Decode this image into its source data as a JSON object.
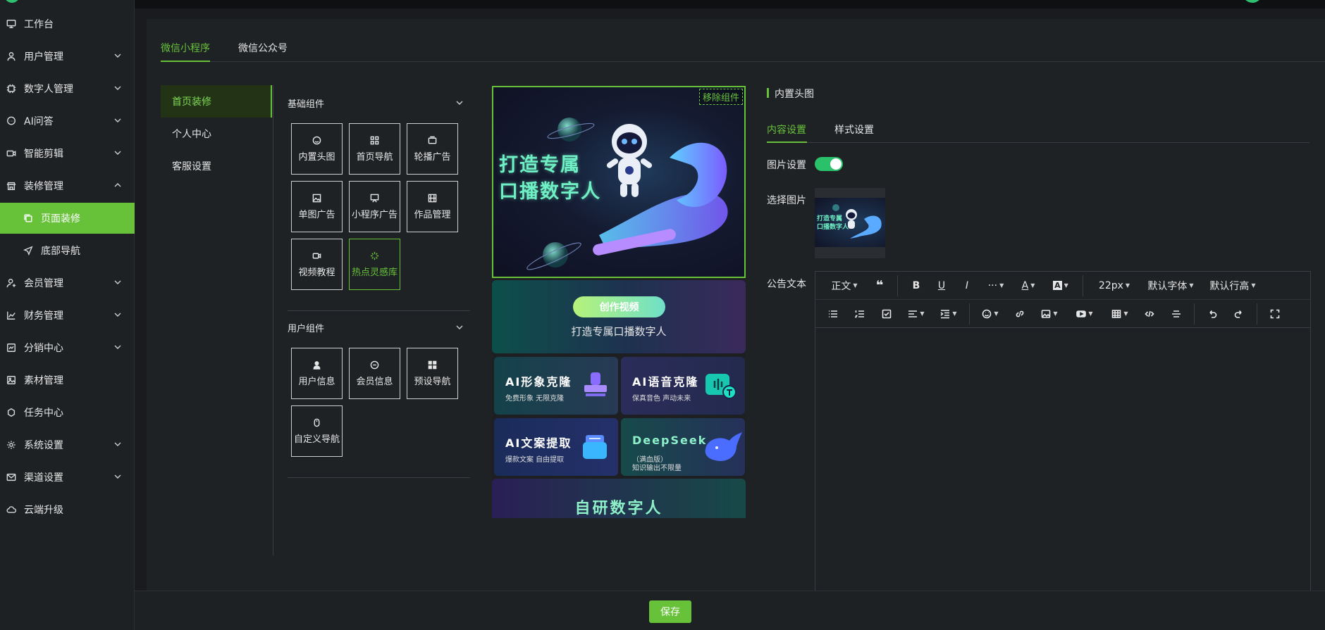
{
  "sidebar": {
    "items": [
      {
        "label": "工作台",
        "icon": "monitor-icon"
      },
      {
        "label": "用户管理",
        "icon": "user-icon"
      },
      {
        "label": "数字人管理",
        "icon": "chip-icon"
      },
      {
        "label": "AI问答",
        "icon": "chat-icon"
      },
      {
        "label": "智能剪辑",
        "icon": "video-icon"
      },
      {
        "label": "装修管理",
        "icon": "store-icon"
      },
      {
        "label": "页面装修",
        "icon": "copy-icon"
      },
      {
        "label": "底部导航",
        "icon": "send-icon"
      },
      {
        "label": "会员管理",
        "icon": "member-icon"
      },
      {
        "label": "财务管理",
        "icon": "chart-icon"
      },
      {
        "label": "分销中心",
        "icon": "share-icon"
      },
      {
        "label": "素材管理",
        "icon": "image-icon"
      },
      {
        "label": "任务中心",
        "icon": "task-icon"
      },
      {
        "label": "系统设置",
        "icon": "gear-icon"
      },
      {
        "label": "渠道设置",
        "icon": "mail-icon"
      },
      {
        "label": "云端升级",
        "icon": "cloud-icon"
      }
    ]
  },
  "top_tabs": [
    "微信小程序",
    "微信公众号"
  ],
  "left_nav": [
    "首页装修",
    "个人中心",
    "客服设置"
  ],
  "components": {
    "basic_title": "基础组件",
    "basic": [
      "内置头图",
      "首页导航",
      "轮播广告",
      "单图广告",
      "小程序广告",
      "作品管理",
      "视频教程",
      "热点灵感库"
    ],
    "user_title": "用户组件",
    "user": [
      "用户信息",
      "会员信息",
      "预设导航",
      "自定义导航"
    ]
  },
  "preview": {
    "remove_label": "移除组件",
    "hero_line1": "打造专属",
    "hero_line2": "口播数字人",
    "create_button": "创作视频",
    "banner_sub": "打造专属口播数字人",
    "cards": [
      {
        "title": "AI形象克隆",
        "sub": "免费形象  无限克隆"
      },
      {
        "title": "AI语音克隆",
        "sub": "保真音色  声动未来"
      },
      {
        "title": "AI文案提取",
        "sub": "爆款文案  自由提取"
      },
      {
        "title": "DeepSeek",
        "sub": "（满血版）",
        "sub2": "知识输出不限量"
      }
    ],
    "bottom_text": "自研数字人"
  },
  "settings": {
    "title": "内置头图",
    "tabs": [
      "内容设置",
      "样式设置"
    ],
    "image_setting_label": "图片设置",
    "image_setting_on": true,
    "choose_image_label": "选择图片",
    "thumb_line1": "打造专属",
    "thumb_line2": "口播数字人",
    "notice_label": "公告文本",
    "toolbar": {
      "heading": "正文",
      "font_size": "22px",
      "font_family": "默认字体",
      "line_height": "默认行高",
      "more": "···"
    }
  },
  "footer": {
    "save_label": "保存"
  },
  "colors": {
    "accent": "#67c23a",
    "toggle": "#2bc16b",
    "background": "#191b1e"
  }
}
